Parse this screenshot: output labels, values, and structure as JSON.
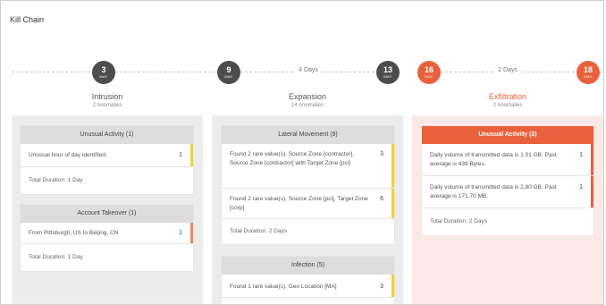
{
  "header": {
    "title": "Kill Chain"
  },
  "timeline": {
    "nodes": [
      {
        "day": "3",
        "month": "MAY",
        "color": "#4d4d4d"
      },
      {
        "day": "9",
        "month": "MAY",
        "color": "#4d4d4d"
      },
      {
        "day": "13",
        "month": "MAY",
        "color": "#4d4d4d"
      },
      {
        "day": "16",
        "month": "MAY",
        "color": "#e8613c"
      },
      {
        "day": "18",
        "month": "MAY",
        "color": "#e8613c"
      }
    ],
    "gaps": [
      "4 Days",
      "2 Days"
    ]
  },
  "stages": [
    {
      "name": "Intrusion",
      "anomalies": "2 Anomalies",
      "cards": [
        {
          "title": "Unusual Activity (1)",
          "rows": [
            {
              "text": "Unusual hour of day identified.",
              "count": "1",
              "severity": "yellow"
            }
          ],
          "duration": "Total Duration: 1 Day"
        },
        {
          "title": "Account Takeover (1)",
          "rows": [
            {
              "text": "From Pittsburgh, US to Beijing, CN",
              "count": "1",
              "severity": "orange"
            }
          ],
          "duration": "Total Duration: 1 Day"
        }
      ]
    },
    {
      "name": "Expansion",
      "anomalies": "14 Anomalies",
      "cards": [
        {
          "title": "Lateral Movement (9)",
          "rows": [
            {
              "text": "Found 2 rare value(s). Source Zone [contractor], Source Zone [contractor] with Target Zone [pci]",
              "count": "3",
              "severity": "yellow"
            },
            {
              "text": "Found 2 rare value(s). Source Zone [pci], Target Zone [corp]",
              "count": "6",
              "severity": "yellow"
            }
          ],
          "duration": "Total Duration: 2 Days"
        },
        {
          "title": "Infection (5)",
          "rows": [
            {
              "text": "Found 1 rare value(s). Geo Location [MA]",
              "count": "3",
              "severity": "yellow"
            }
          ],
          "duration": ""
        }
      ]
    },
    {
      "name": "Exfiltration",
      "anomalies": "2 Anomalies",
      "color": "#e8613c",
      "cards": [
        {
          "title": "Unusual Activity (2)",
          "rows": [
            {
              "text": "Daily volume of transmitted data is 1.01 GB. Past average is 439 Bytes.",
              "count": "1",
              "severity": "red"
            },
            {
              "text": "Daily volume of transmitted data is 2.80 GB. Past average is 171.70 MB.",
              "count": "1",
              "severity": "red"
            }
          ],
          "duration": "Total Duration: 2 Days"
        }
      ]
    }
  ]
}
